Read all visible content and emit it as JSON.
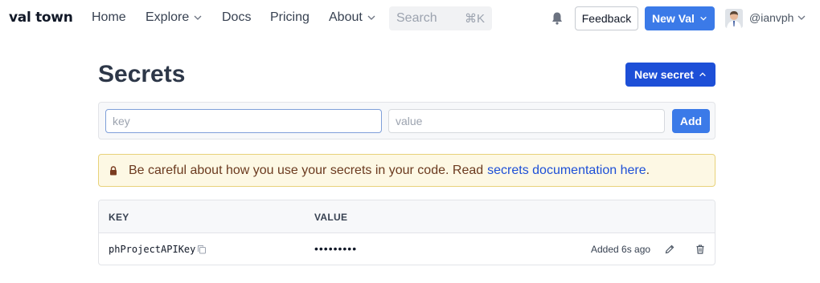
{
  "nav": {
    "logo": "val town",
    "links": [
      {
        "label": "Home",
        "dropdown": false
      },
      {
        "label": "Explore",
        "dropdown": true
      },
      {
        "label": "Docs",
        "dropdown": false
      },
      {
        "label": "Pricing",
        "dropdown": false
      },
      {
        "label": "About",
        "dropdown": true
      }
    ],
    "search": {
      "placeholder": "Search",
      "shortcut": "⌘K"
    },
    "notifications_icon": "bell-icon",
    "feedback_label": "Feedback",
    "new_val_label": "New Val",
    "username": "@ianvph"
  },
  "page": {
    "title": "Secrets",
    "new_secret_label": "New secret"
  },
  "form": {
    "key_placeholder": "key",
    "value_placeholder": "value",
    "add_label": "Add"
  },
  "warning": {
    "icon": "lock-icon",
    "text": "Be careful about how you use your secrets in your code. Read",
    "link_text": "secrets documentation here",
    "suffix": "."
  },
  "table": {
    "columns": [
      "KEY",
      "VALUE"
    ],
    "rows": [
      {
        "key": "phProjectAPIKey",
        "value": "•••••••••",
        "added": "Added 6s ago"
      }
    ]
  },
  "colors": {
    "primary": "#3b7ae8",
    "primary_dark": "#1d4fd7",
    "warning_bg": "#fdf8e4",
    "warning_border": "#e8d27a"
  }
}
